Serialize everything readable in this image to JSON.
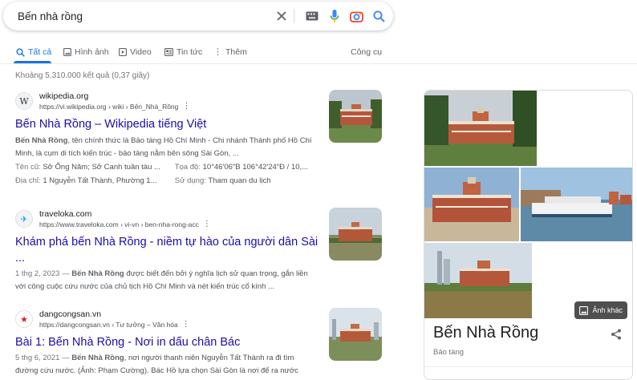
{
  "search": {
    "query": "Bến nhà rồng"
  },
  "icons": {
    "clear": "close-icon",
    "keyboard": "keyboard-icon",
    "voice": "microphone-icon",
    "lens": "camera-icon",
    "search": "search-icon"
  },
  "tabs": [
    {
      "label": "Tất cả",
      "icon": "search-icon",
      "active": true
    },
    {
      "label": "Hình ảnh",
      "icon": "image-icon"
    },
    {
      "label": "Video",
      "icon": "video-icon"
    },
    {
      "label": "Tin tức",
      "icon": "news-icon"
    },
    {
      "label": "Thêm",
      "icon": "more-vert-icon"
    }
  ],
  "tools_label": "Công cụ",
  "stats": "Khoảng 5.310.000 kết quả (0,37 giây)",
  "results": [
    {
      "site": "wikipedia.org",
      "url": "https://vi.wikipedia.org › wiki › Bến_Nhà_Rồng",
      "favicon": "W",
      "title": "Bến Nhà Rồng – Wikipedia tiếng Việt",
      "snippet_bold": "Bến Nhà Rồng",
      "snippet": ", tên chính thức là Bảo tàng Hồ Chí Minh - Chi nhánh Thành phố Hồ Chí Minh, là cụm di tích kiến trúc - bảo tàng nằm bên sông Sài Gòn, ...",
      "meta": [
        {
          "label": "Tên cũ:",
          "value": "Sở Ống Năm; Sở Canh tuần tàu ..."
        },
        {
          "label": "Tọa độ:",
          "value": "10°46′06″B 106°42′24″Đ / 10,..."
        },
        {
          "label": "Địa chỉ:",
          "value": "1 Nguyễn Tất Thành, Phường 1..."
        },
        {
          "label": "Sử dụng:",
          "value": "Tham quan du lịch"
        }
      ]
    },
    {
      "site": "traveloka.com",
      "url": "https://www.traveloka.com › vi-vn › ben-nha-rong-acc",
      "favicon": "✈",
      "title": "Khám phá bến Nhà Rồng - niềm tự hào của người dân Sài",
      "title_cont": "...",
      "date": "1 thg 2, 2023 —",
      "snippet_bold": "Bến Nhà Rồng",
      "snippet": " được biết đến bởi ý nghĩa lịch sử quan trọng, gắn liền với công cuộc cứu nước của chủ tịch Hồ Chí Minh và nét kiến trúc cổ kính ..."
    },
    {
      "site": "dangcongsan.vn",
      "url": "https://dangcongsan.vn › Tư tưởng – Văn hóa",
      "favicon": "★",
      "title": "Bài 1: Bến Nhà Rồng - Nơi in dấu chân Bác",
      "date": "5 thg 6, 2021 —",
      "snippet_bold": "Bến Nhà Rồng",
      "snippet": ", nơi người thanh niên Nguyễn Tất Thành ra đi tìm đường cứu nước. (Ảnh: Phạm Cường). Bác Hồ lựa chọn Sài Gòn là nơi để ra nước"
    }
  ],
  "knowledge_panel": {
    "title": "Bến Nhà Rồng",
    "subtitle": "Bảo tàng",
    "more_images": "Ảnh khác"
  },
  "colors": {
    "link": "#1a0dab",
    "accent": "#1a73e8",
    "text": "#202124",
    "muted": "#70757a"
  }
}
